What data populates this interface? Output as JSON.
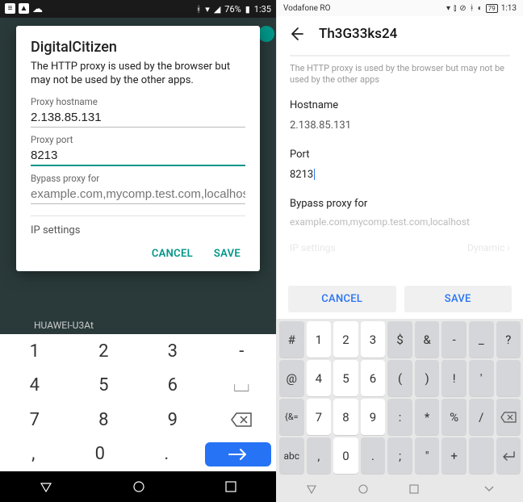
{
  "left": {
    "statusbar": {
      "battery_pct": "76%",
      "time": "1:35"
    },
    "dialog": {
      "title": "DigitalCitizen",
      "help": "The HTTP proxy is used by the browser but may not be used by the other apps.",
      "hostname_label": "Proxy hostname",
      "hostname_value": "2.138.85.131",
      "port_label": "Proxy port",
      "port_value": "8213",
      "bypass_label": "Bypass proxy for",
      "bypass_placeholder": "example.com,mycomp.test.com,localhost",
      "ip_label": "IP settings",
      "cancel": "CANCEL",
      "save": "SAVE"
    },
    "bg_ssid": "HUAWEI-U3At",
    "keyboard": {
      "rows": [
        [
          "1",
          "2",
          "3",
          "-"
        ],
        [
          "4",
          "5",
          "6",
          "⎵"
        ],
        [
          "7",
          "8",
          "9",
          "⌫"
        ],
        [
          ",",
          "0",
          ".",
          "→"
        ]
      ]
    }
  },
  "right": {
    "statusbar": {
      "carrier": "Vodafone RO",
      "battery_pct": "79",
      "time": "1:13"
    },
    "appbar": {
      "title": "Th3G33ks24"
    },
    "help": "The HTTP proxy is used by the browser but may not be used by the other apps",
    "hostname_label": "Hostname",
    "hostname_value": "2.138.85.131",
    "port_label": "Port",
    "port_value": "8213",
    "bypass_label": "Bypass proxy for",
    "bypass_placeholder": "example.com,mycomp.test.com,localhost",
    "ip_label": "IP settings",
    "ip_value": "Dynamic",
    "cancel": "CANCEL",
    "save": "SAVE",
    "keyboard": {
      "row1": [
        "#",
        "1",
        "2",
        "3",
        "$",
        "&",
        "-",
        "_",
        "?"
      ],
      "row2": [
        "@",
        "4",
        "5",
        "6",
        "(",
        ")",
        "!",
        "'",
        ""
      ],
      "row3": [
        "{&=",
        "7",
        "8",
        "9",
        ":",
        "*",
        "%",
        "/",
        "⌫"
      ],
      "row4": [
        "abc",
        ",",
        "0",
        ".",
        ";",
        "\"",
        "+",
        "",
        "↵"
      ]
    }
  }
}
